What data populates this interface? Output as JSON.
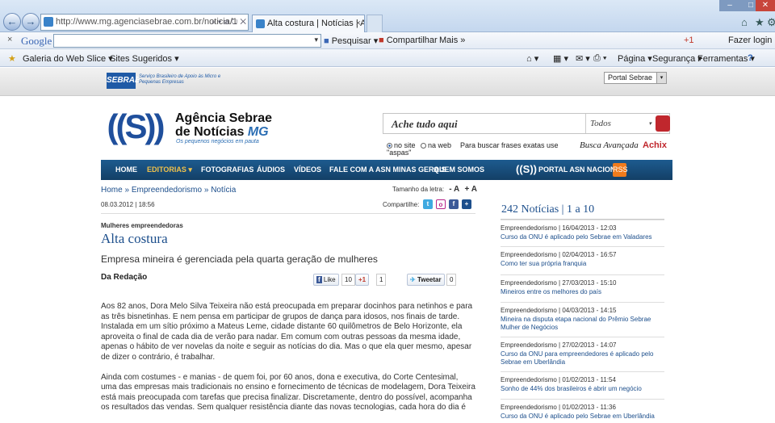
{
  "browser": {
    "back": "←",
    "forward": "→",
    "address": "http://www.mg.agenciasebrae.com.br/noticia/1",
    "address_tools": "⌕ ▾ ⊞ ↻ ✕",
    "tab_active": "Alta costura | Notícias | Agê...",
    "tab_active_close": "×",
    "win_min": "–",
    "win_max": "□",
    "win_close": "✕",
    "home_icon": "⌂",
    "star_icon": "★",
    "gear_icon": "⚙"
  },
  "google_toolbar": {
    "close": "×",
    "logo": "Google",
    "search_value": "",
    "pesquisar": "Pesquisar ▾",
    "compartilhar": "Compartilhar",
    "mais": "Mais »",
    "fazer_login": "Fazer login"
  },
  "favorites_bar": {
    "galeria": "Galeria do Web Slice ▾",
    "sites": "Sites Sugeridos ▾",
    "pagina": "Página ▾",
    "seguranca": "Segurança ▾",
    "ferramentas": "Ferramentas ▾",
    "help": "?"
  },
  "sebrae_strip": {
    "logo": "SEBRAE",
    "tagline": "Serviço Brasileiro de Apoio às Micro e Pequenas Empresas",
    "portal_select": "Portal Sebrae",
    "select_arrow": "▾"
  },
  "header": {
    "mark": "((S))",
    "name_line1": "Agência Sebrae",
    "name_line2": "de Notícias",
    "name_mg": "MG",
    "tagline": "Os pequenos negócios em pauta",
    "search_placeholder": "Ache tudo aqui",
    "search_category": "Todos",
    "radio_site": "no site",
    "radio_web": "na web",
    "hint": "Para buscar frases exatas use",
    "hint2": "\"aspas\"",
    "busca_avancada": "Busca Avançada",
    "achix": "Achix"
  },
  "nav": {
    "home": "HOME",
    "editorias": "EDITORIAS ▾",
    "fotografias": "FOTOGRAFIAS",
    "audios": "ÁUDIOS",
    "videos": "VÍDEOS",
    "fale": "FALE COM A ASN MINAS GERAIS",
    "quem_somos": "QUEM SOMOS",
    "asn_icon": "((S))",
    "portal_nacional": "PORTAL ASN NACIONAL",
    "rss": "RSS"
  },
  "article": {
    "breadcrumb_home": "Home",
    "breadcrumb_sep": "»",
    "breadcrumb_cat": "Empreendedorismo",
    "breadcrumb_cur": "Notícia",
    "font_size_label": "Tamanho da letra:",
    "font_minus": "- A",
    "font_plus": "+ A",
    "date": "08.03.2012 | 18:56",
    "share_label": "Compartilhe:",
    "kicker": "Mulheres empreendedoras",
    "title": "Alta costura",
    "subtitle": "Empresa mineira é gerenciada pela quarta geração de mulheres",
    "author": "Da Redação",
    "fb_like": "Like",
    "fb_count": "10",
    "gplus": "+1",
    "gplus_count": "1",
    "tweet": "Tweetar",
    "tweet_count": "0",
    "paragraphs": [
      "Aos 82 anos, Dora Melo Silva Teixeira não está preocupada em preparar docinhos para netinhos e para as três bisnetinhas. E nem pensa em participar de grupos de dança para idosos, nos finais de tarde. Instalada em um sítio próximo a Mateus Leme, cidade distante 60 quilômetros de Belo Horizonte, ela aproveita o final de cada dia de verão para nadar. Em comum com outras pessoas da mesma idade, apenas o hábito de ver novelas da noite e seguir as notícias do dia. Mas o que ela quer mesmo, apesar de dizer o contrário, é trabalhar.",
      "Ainda com costumes - e manias - de quem foi, por 60 anos, dona e executiva, do Corte Centesimal, uma das empresas mais tradicionais no ensino e fornecimento de técnicas de modelagem, Dora Teixeira está mais preocupada com tarefas que precisa finalizar. Discretamente, dentro do possível, acompanha os resultados das vendas. Sem qualquer resistência diante das novas tecnologias, cada hora do dia é"
    ]
  },
  "sidebar": {
    "title": "242 Notícias | 1 a 10",
    "items": [
      {
        "meta": "Empreendedorismo | 16/04/2013 - 12:03",
        "headline": "Curso da ONU é aplicado pelo Sebrae em Valadares"
      },
      {
        "meta": "Empreendedorismo | 02/04/2013 - 16:57",
        "headline": "Como ter sua própria franquia"
      },
      {
        "meta": "Empreendedorismo | 27/03/2013 - 15:10",
        "headline": "Mineiros entre os melhores do país"
      },
      {
        "meta": "Empreendedorismo | 04/03/2013 - 14:15",
        "headline": "Mineira na disputa etapa nacional do Prêmio Sebrae Mulher de Negócios"
      },
      {
        "meta": "Empreendedorismo | 27/02/2013 - 14:07",
        "headline": "Curso da ONU para empreendedores é aplicado pelo Sebrae em Uberlândia"
      },
      {
        "meta": "Empreendedorismo | 01/02/2013 - 11:54",
        "headline": "Sonho de 44% dos brasileiros é abrir um negócio"
      },
      {
        "meta": "Empreendedorismo | 01/02/2013 - 11:36",
        "headline": "Curso da ONU é aplicado pelo Sebrae em Uberlândia"
      }
    ]
  }
}
